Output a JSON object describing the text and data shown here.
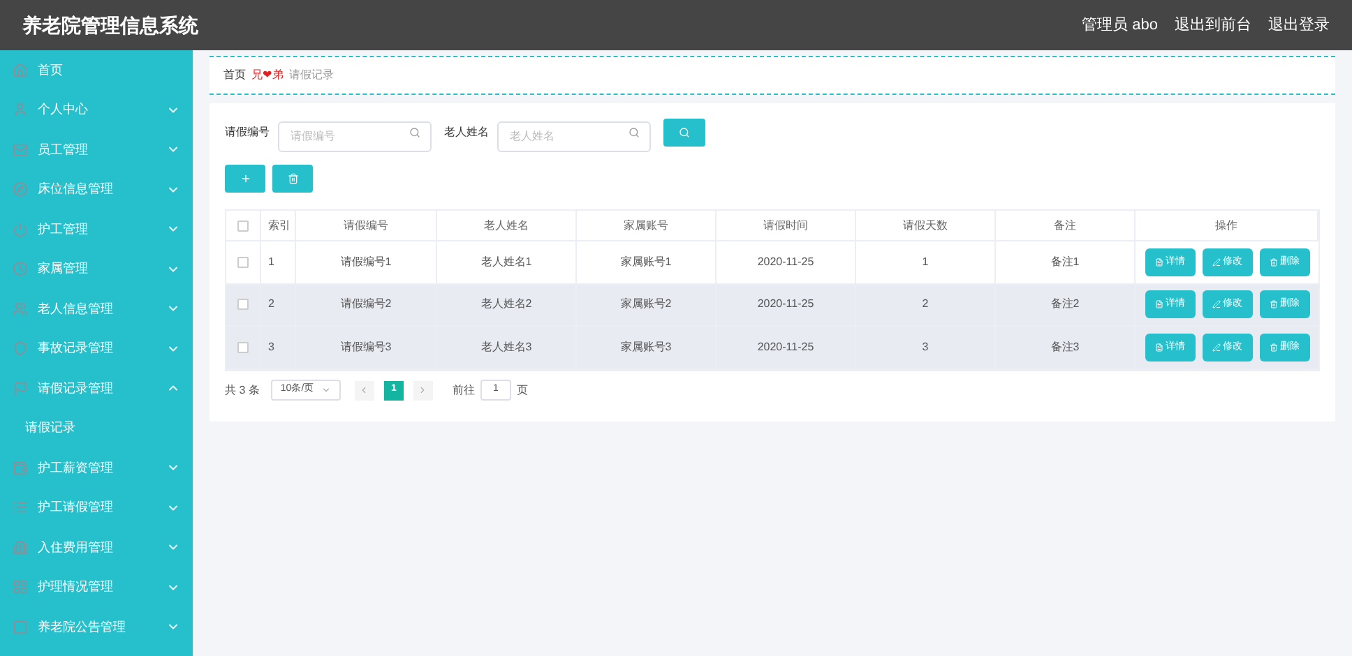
{
  "header": {
    "title": "养老院管理信息系统",
    "links": [
      "管理员 abo",
      "退出到前台",
      "退出登录"
    ]
  },
  "sidebar": {
    "items": [
      {
        "label": "首页"
      },
      {
        "label": "个人中心",
        "expanded": false
      },
      {
        "label": "员工管理",
        "expanded": false
      },
      {
        "label": "床位信息管理",
        "expanded": false
      },
      {
        "label": "护工管理",
        "expanded": false
      },
      {
        "label": "家属管理",
        "expanded": false
      },
      {
        "label": "老人信息管理",
        "expanded": false
      },
      {
        "label": "事故记录管理",
        "expanded": false
      },
      {
        "label": "请假记录管理",
        "expanded": true,
        "children": [
          {
            "label": "请假记录"
          }
        ]
      },
      {
        "label": "护工薪资管理",
        "expanded": false
      },
      {
        "label": "护工请假管理",
        "expanded": false
      },
      {
        "label": "入住费用管理",
        "expanded": false
      },
      {
        "label": "护理情况管理",
        "expanded": false
      },
      {
        "label": "养老院公告管理",
        "expanded": false
      }
    ]
  },
  "breadcrumb": {
    "home": "首页",
    "separator": "兄❤弟",
    "current": "请假记录"
  },
  "search": {
    "fields": [
      {
        "label": "请假编号",
        "placeholder": "请假编号"
      },
      {
        "label": "老人姓名",
        "placeholder": "老人姓名"
      }
    ]
  },
  "table": {
    "columns": [
      "索引",
      "请假编号",
      "老人姓名",
      "家属账号",
      "请假时间",
      "请假天数",
      "备注",
      "操作"
    ],
    "select_all_checked": false,
    "rows": [
      {
        "checked": false,
        "highlighted": false,
        "cells": [
          "1",
          "请假编号1",
          "老人姓名1",
          "家属账号1",
          "2020-11-25",
          "1",
          "备注1"
        ],
        "actions": [
          "详情",
          "修改",
          "删除"
        ]
      },
      {
        "checked": false,
        "highlighted": true,
        "cells": [
          "2",
          "请假编号2",
          "老人姓名2",
          "家属账号2",
          "2020-11-25",
          "2",
          "备注2"
        ],
        "actions": [
          "详情",
          "修改",
          "删除"
        ]
      },
      {
        "checked": false,
        "highlighted": true,
        "cells": [
          "3",
          "请假编号3",
          "老人姓名3",
          "家属账号3",
          "2020-11-25",
          "3",
          "备注3"
        ],
        "actions": [
          "详情",
          "修改",
          "删除"
        ]
      }
    ]
  },
  "pagination": {
    "total": "共 3 条",
    "page_size": "10条/页",
    "pages": [
      {
        "label": "1",
        "selected": true
      }
    ],
    "goto_label": "前往",
    "goto_value": "1",
    "goto_suffix": "页"
  }
}
